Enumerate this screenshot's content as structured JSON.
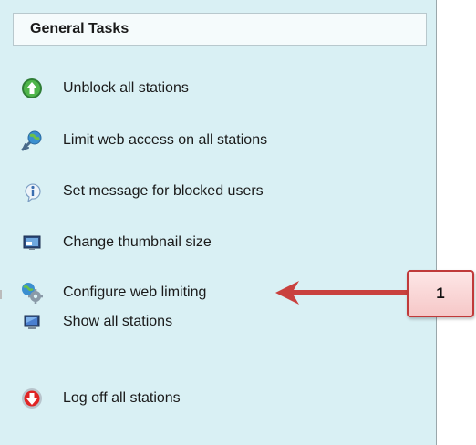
{
  "panel": {
    "title": "General Tasks",
    "items": [
      {
        "label": "Unblock all stations",
        "icon": "unblock-green-arrow-icon"
      },
      {
        "label": "Limit web access on all stations",
        "icon": "globe-limit-icon"
      },
      {
        "label": "Set message for blocked users",
        "icon": "info-message-icon"
      },
      {
        "label": "Change thumbnail size",
        "icon": "thumbnail-monitor-icon"
      },
      {
        "label": "Configure web limiting",
        "icon": "gear-globe-icon"
      },
      {
        "label": "Show all stations",
        "icon": "monitor-icon"
      },
      {
        "label": "Log off all stations",
        "icon": "logoff-red-arrow-icon"
      }
    ]
  },
  "callout": {
    "number": "1",
    "color": "#c03a3a"
  },
  "colors": {
    "panel_background": "#d9f0f4",
    "header_background": "#f5fbfc"
  }
}
